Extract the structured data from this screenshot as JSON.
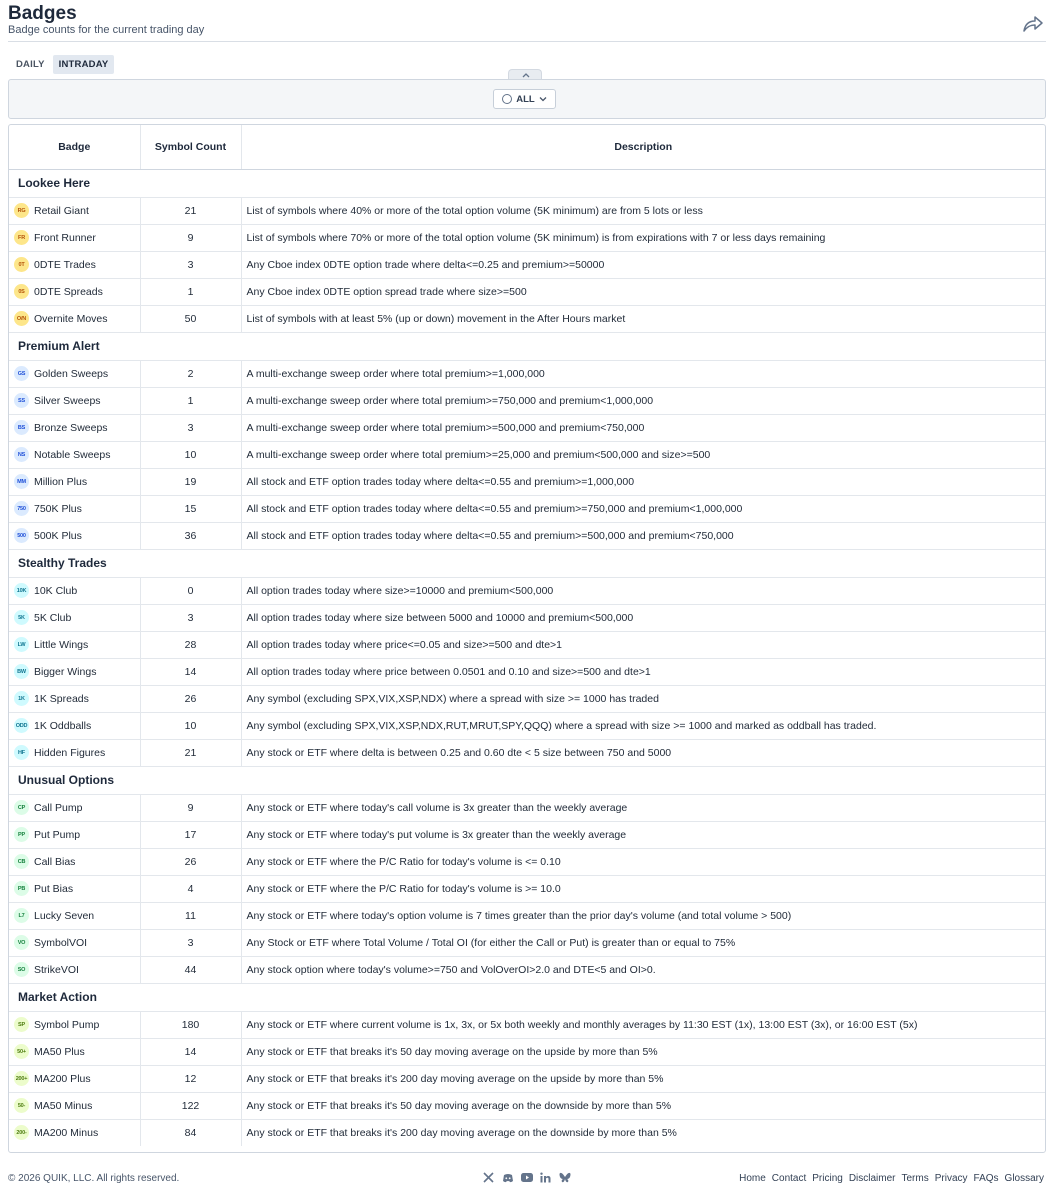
{
  "header": {
    "title": "Badges",
    "subtitle": "Badge counts for the current trading day"
  },
  "tabs": [
    {
      "label": "DAILY"
    },
    {
      "label": "INTRADAY"
    }
  ],
  "filter": {
    "label": "ALL"
  },
  "table": {
    "columns": [
      "Badge",
      "Symbol Count",
      "Description"
    ],
    "groups": [
      {
        "name": "Lookee Here",
        "chip_bg": "#fde68a",
        "chip_fg": "#b45309",
        "rows": [
          {
            "code": "RG",
            "name": "Retail Giant",
            "count": "21",
            "desc": "List of symbols where 40% or more of the total option volume (5K minimum) are from 5 lots or less"
          },
          {
            "code": "FR",
            "name": "Front Runner",
            "count": "9",
            "desc": "List of symbols where 70% or more of the total option volume (5K minimum) is from expirations with 7 or less days remaining"
          },
          {
            "code": "0T",
            "name": "0DTE Trades",
            "count": "3",
            "desc": "Any Cboe index 0DTE option trade where delta<=0.25 and premium>=50000"
          },
          {
            "code": "0S",
            "name": "0DTE Spreads",
            "count": "1",
            "desc": "Any Cboe index 0DTE option spread trade where size>=500"
          },
          {
            "code": "O/N",
            "name": "Overnite Moves",
            "count": "50",
            "desc": "List of symbols with at least 5% (up or down) movement in the After Hours market"
          }
        ]
      },
      {
        "name": "Premium Alert",
        "chip_bg": "#dbeafe",
        "chip_fg": "#1d4ed8",
        "rows": [
          {
            "code": "GS",
            "name": "Golden Sweeps",
            "count": "2",
            "desc": "A multi-exchange sweep order where total premium>=1,000,000"
          },
          {
            "code": "SS",
            "name": "Silver Sweeps",
            "count": "1",
            "desc": "A multi-exchange sweep order where total premium>=750,000 and premium<1,000,000"
          },
          {
            "code": "BS",
            "name": "Bronze Sweeps",
            "count": "3",
            "desc": "A multi-exchange sweep order where total premium>=500,000 and premium<750,000"
          },
          {
            "code": "NS",
            "name": "Notable Sweeps",
            "count": "10",
            "desc": "A multi-exchange sweep order where total premium>=25,000 and premium<500,000 and size>=500"
          },
          {
            "code": "MM",
            "name": "Million Plus",
            "count": "19",
            "desc": "All stock and ETF option trades today where delta<=0.55 and premium>=1,000,000"
          },
          {
            "code": "750",
            "name": "750K Plus",
            "count": "15",
            "desc": "All stock and ETF option trades today where delta<=0.55 and premium>=750,000 and premium<1,000,000"
          },
          {
            "code": "500",
            "name": "500K Plus",
            "count": "36",
            "desc": "All stock and ETF option trades today where delta<=0.55 and premium>=500,000 and premium<750,000"
          }
        ]
      },
      {
        "name": "Stealthy Trades",
        "chip_bg": "#cffafe",
        "chip_fg": "#0e7490",
        "rows": [
          {
            "code": "10K",
            "name": "10K Club",
            "count": "0",
            "desc": "All option trades today where size>=10000 and premium<500,000"
          },
          {
            "code": "5K",
            "name": "5K Club",
            "count": "3",
            "desc": "All option trades today where size between 5000 and 10000 and premium<500,000"
          },
          {
            "code": "LW",
            "name": "Little Wings",
            "count": "28",
            "desc": "All option trades today where price<=0.05 and size>=500 and dte>1"
          },
          {
            "code": "BW",
            "name": "Bigger Wings",
            "count": "14",
            "desc": "All option trades today where price between 0.0501 and 0.10 and size>=500 and dte>1"
          },
          {
            "code": "1K",
            "name": "1K Spreads",
            "count": "26",
            "desc": "Any symbol (excluding SPX,VIX,XSP,NDX) where a spread with size >= 1000 has traded"
          },
          {
            "code": "ODD",
            "name": "1K Oddballs",
            "count": "10",
            "desc": "Any symbol (excluding SPX,VIX,XSP,NDX,RUT,MRUT,SPY,QQQ) where a spread with size >= 1000 and marked as oddball has traded."
          },
          {
            "code": "HF",
            "name": "Hidden Figures",
            "count": "21",
            "desc": "Any stock or ETF where delta is between 0.25 and 0.60 dte < 5 size between 750 and 5000"
          }
        ]
      },
      {
        "name": "Unusual Options",
        "chip_bg": "#dcfce7",
        "chip_fg": "#15803d",
        "rows": [
          {
            "code": "CP",
            "name": "Call Pump",
            "count": "9",
            "desc": "Any stock or ETF where today's call volume is 3x greater than the weekly average"
          },
          {
            "code": "PP",
            "name": "Put Pump",
            "count": "17",
            "desc": "Any stock or ETF where today's put volume is 3x greater than the weekly average"
          },
          {
            "code": "CB",
            "name": "Call Bias",
            "count": "26",
            "desc": "Any stock or ETF where the P/C Ratio for today's volume is <= 0.10"
          },
          {
            "code": "PB",
            "name": "Put Bias",
            "count": "4",
            "desc": "Any stock or ETF where the P/C Ratio for today's volume is >= 10.0"
          },
          {
            "code": "L7",
            "name": "Lucky Seven",
            "count": "11",
            "desc": "Any stock or ETF where today's option volume is 7 times greater than the prior day's volume (and total volume > 500)"
          },
          {
            "code": "VO",
            "name": "SymbolVOI",
            "count": "3",
            "desc": "Any Stock or ETF where Total Volume / Total OI (for either the Call or Put) is greater than or equal to 75%"
          },
          {
            "code": "SO",
            "name": "StrikeVOI",
            "count": "44",
            "desc": "Any stock option where today's volume>=750 and VolOverOI>2.0 and DTE<5 and OI>0."
          }
        ]
      },
      {
        "name": "Market Action",
        "chip_bg": "#ecfccb",
        "chip_fg": "#4d7c0f",
        "rows": [
          {
            "code": "SP",
            "name": "Symbol Pump",
            "count": "180",
            "desc": "Any stock or ETF where current volume is 1x, 3x, or 5x both weekly and monthly averages by 11:30 EST (1x), 13:00 EST (3x), or 16:00 EST (5x)"
          },
          {
            "code": "50+",
            "name": "MA50 Plus",
            "count": "14",
            "desc": "Any stock or ETF that breaks it's 50 day moving average on the upside by more than 5%"
          },
          {
            "code": "200+",
            "name": "MA200 Plus",
            "count": "12",
            "desc": "Any stock or ETF that breaks it's 200 day moving average on the upside by more than 5%"
          },
          {
            "code": "50-",
            "name": "MA50 Minus",
            "count": "122",
            "desc": "Any stock or ETF that breaks it's 50 day moving average on the downside by more than 5%"
          },
          {
            "code": "200-",
            "name": "MA200 Minus",
            "count": "84",
            "desc": "Any stock or ETF that breaks it's 200 day moving average on the downside by more than 5%"
          }
        ]
      }
    ]
  },
  "footer": {
    "copyright": "© 2026 QUIK, LLC. All rights reserved.",
    "socials": [
      "x-icon",
      "discord-icon",
      "youtube-icon",
      "linkedin-icon",
      "bluesky-icon"
    ],
    "links": [
      "Home",
      "Contact",
      "Pricing",
      "Disclaimer",
      "Terms",
      "Privacy",
      "FAQs",
      "Glossary"
    ]
  }
}
